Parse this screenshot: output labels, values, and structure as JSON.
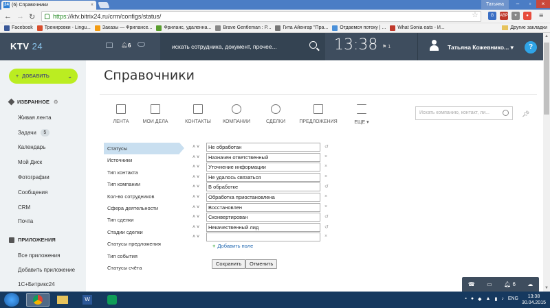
{
  "browser": {
    "tab_title": "(6) Справочники",
    "favicon_text": "24",
    "user_badge": "Татьяна",
    "url_https": "https",
    "url_rest": "://ktv.bitrix24.ru/crm/configs/status/",
    "bookmarks": [
      {
        "label": "Facebook",
        "color": "#3b5998"
      },
      {
        "label": "Тренировки - Lingu...",
        "color": "#d94d2c"
      },
      {
        "label": "Заказы — Фрилансе...",
        "color": "#f39c12"
      },
      {
        "label": "Фриланс, удаленна...",
        "color": "#5a9e2f"
      },
      {
        "label": "Brave Gentleman : P...",
        "color": "#888888"
      },
      {
        "label": "Гита Айенгар \"Пра...",
        "color": "#777777"
      },
      {
        "label": "Отдаемся потоку | ...",
        "color": "#4a90d9"
      },
      {
        "label": "What Sonia eats - И...",
        "color": "#c0392b"
      }
    ],
    "other_bookmarks": "Другие закладки"
  },
  "topbar": {
    "logo_main": "KTV",
    "logo_num": "24",
    "notif_count": "6",
    "search_placeholder": "искать сотрудника, документ, прочее...",
    "clock": "13:38",
    "flag_count": "1",
    "user_name": "Татьяна Кожевнико...",
    "help": "?"
  },
  "sidebar": {
    "add_button": "ДОБАВИТЬ",
    "favorites_header": "ИЗБРАННОЕ",
    "items": [
      {
        "label": "Живая лента"
      },
      {
        "label": "Задачи",
        "badge": "5"
      },
      {
        "label": "Календарь"
      },
      {
        "label": "Мой Диск"
      },
      {
        "label": "Фотографии"
      },
      {
        "label": "Сообщения"
      },
      {
        "label": "CRM"
      },
      {
        "label": "Почта"
      }
    ],
    "apps_header": "ПРИЛОЖЕНИЯ",
    "app_items": [
      {
        "label": "Все приложения"
      },
      {
        "label": "Добавить приложение"
      },
      {
        "label": "1С+Битрикс24"
      }
    ]
  },
  "page_title": "Справочники",
  "crm_nav": {
    "items": [
      {
        "label": "ЛЕНТА",
        "icon": "feed-icon"
      },
      {
        "label": "МОИ ДЕЛА",
        "icon": "tasks-icon"
      },
      {
        "label": "КОНТАКТЫ",
        "icon": "contacts-icon"
      },
      {
        "label": "КОМПАНИИ",
        "icon": "companies-icon"
      },
      {
        "label": "СДЕЛКИ",
        "icon": "deals-icon"
      },
      {
        "label": "ПРЕДЛОЖЕНИЯ",
        "icon": "offers-icon"
      },
      {
        "label": "ЕЩЕ",
        "icon": "more-icon"
      }
    ],
    "search_placeholder": "Искать компанию, контакт, ли..."
  },
  "directory_menu": [
    "Статусы",
    "Источники",
    "Тип контакта",
    "Тип компании",
    "Кол-во сотрудников",
    "Сфера деятельности",
    "Тип сделки",
    "Стадии сделки",
    "Статусы предложения",
    "Тип события",
    "Статусы счёта"
  ],
  "statuses": [
    "Не обработан",
    "Назначен ответственный",
    "Уточнение информации",
    "Не удалось связаться",
    "В обработке",
    "Обработка приостановлена",
    "Восстановлен",
    "Сконвертирован",
    "Некачественный лид",
    ""
  ],
  "add_field": "Добавить поле",
  "buttons": {
    "save": "Сохранить",
    "cancel": "Отменить"
  },
  "fixed_bar": {
    "count": "6"
  },
  "taskbar": {
    "lang": "ENG",
    "time": "13:38",
    "date": "30.04.2015"
  }
}
